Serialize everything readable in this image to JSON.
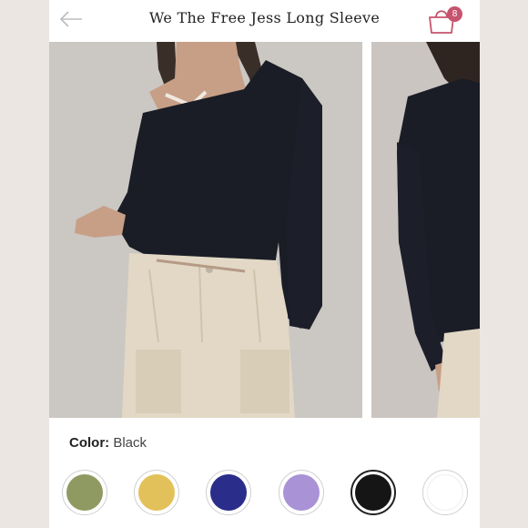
{
  "header": {
    "title": "We The Free Jess Long Sleeve",
    "cart_count": "8",
    "back_icon": "arrow-left-icon",
    "cart_icon": "shopping-bag-icon"
  },
  "gallery": {
    "images": [
      {
        "name": "product-photo-front"
      },
      {
        "name": "product-photo-side"
      }
    ]
  },
  "color": {
    "label": "Color:",
    "selected": "Black",
    "swatches": [
      {
        "name": "olive",
        "hex": "#8f9a62",
        "selected": false
      },
      {
        "name": "mustard",
        "hex": "#e3c15a",
        "selected": false
      },
      {
        "name": "navy",
        "hex": "#2a2d8a",
        "selected": false
      },
      {
        "name": "lavender",
        "hex": "#a992d6",
        "selected": false
      },
      {
        "name": "black",
        "hex": "#151515",
        "selected": true
      },
      {
        "name": "white",
        "hex": "#ffffff",
        "selected": false
      }
    ]
  },
  "colors": {
    "accent": "#c6546e",
    "shirt": "#1a1d26",
    "pants": "#e2d8c5"
  }
}
